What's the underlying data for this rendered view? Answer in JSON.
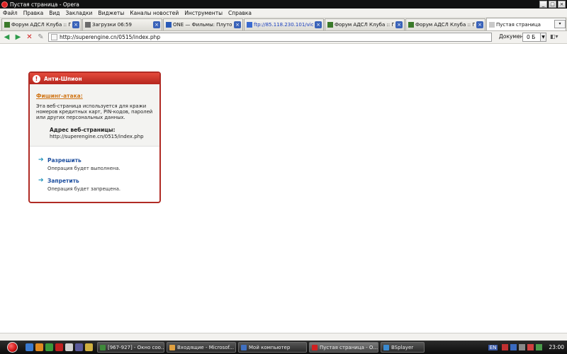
{
  "window": {
    "title": "Пустая страница - Opera",
    "controls": [
      "_",
      "□",
      "×"
    ]
  },
  "menu": [
    "Файл",
    "Правка",
    "Вид",
    "Закладки",
    "Виджеты",
    "Каналы новостей",
    "Инструменты",
    "Справка"
  ],
  "tabs": [
    {
      "label": "Форум АДСЛ Клуба :: П...",
      "icon_color": "#3b7a2a",
      "active": false,
      "link": false
    },
    {
      "label": "Загрузки 06:59",
      "icon_color": "#6a6a6a",
      "active": false,
      "link": false
    },
    {
      "label": "ONE — Фильмы: Плутов...",
      "icon_color": "#2a5ab8",
      "active": false,
      "link": false
    },
    {
      "label": "ftp://85.118.230.101/vid...",
      "icon_color": "#3a6ad0",
      "active": false,
      "link": true
    },
    {
      "label": "Форум АДСЛ Клуба :: П...",
      "icon_color": "#3b7a2a",
      "active": false,
      "link": false
    },
    {
      "label": "Форум АДСЛ Клуба :: П...",
      "icon_color": "#3b7a2a",
      "active": false,
      "link": false
    },
    {
      "label": "Пустая страница",
      "icon_color": "#c8c8c8",
      "active": true,
      "link": false
    }
  ],
  "address": {
    "url": "http://superengine.cn/0515/index.php",
    "document_label": "Документ:",
    "document_value": "0 Б"
  },
  "dialog": {
    "title": "Анти-Шпион",
    "warning_symbol": "!",
    "phishing_heading": "Фишинг-атака:",
    "description": "Эта веб-страница используется для кражи номеров кредитных карт, PIN-кодов, паролей или других персональных данных.",
    "address_label": "Адрес веб-страницы:",
    "address_value": "http://superengine.cn/0515/index.php",
    "allow_label": "Разрешить",
    "allow_sub": "Операция будет выполнена.",
    "deny_label": "Запретить",
    "deny_sub": "Операция будет запрещена."
  },
  "taskbar": {
    "buttons": [
      {
        "label": "[967-927] - Окно соо...",
        "icon_color": "#3f8a3a",
        "active": false
      },
      {
        "label": "Входящие - Microsof...",
        "icon_color": "#e0a040",
        "active": false
      },
      {
        "label": "Мой компьютер",
        "icon_color": "#4070c0",
        "active": false
      },
      {
        "label": "Пустая страница - О...",
        "icon_color": "#d02020",
        "active": true
      },
      {
        "label": "BSplayer",
        "icon_color": "#3a8ad0",
        "active": false
      }
    ],
    "lang": "EN",
    "clock": "23:00"
  }
}
